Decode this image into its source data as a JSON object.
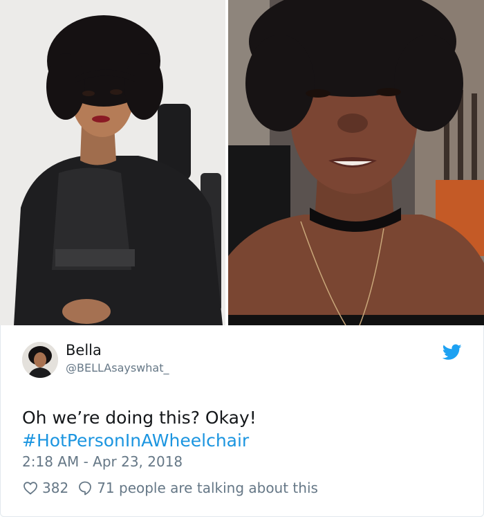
{
  "tweet": {
    "display_name": "Bella",
    "handle": "@BELLAsayswhat_",
    "text": "Oh we’re doing this? Okay!",
    "hashtag": "#HotPersonInAWheelchair",
    "timestamp": "2:18 AM - Apr 23, 2018",
    "likes": "382",
    "replies": "71 people are talking about this"
  },
  "colors": {
    "link": "#1b95e0",
    "muted": "#657786",
    "text": "#14171a",
    "twitter_blue": "#1da1f2"
  },
  "icons": {
    "brand": "twitter-bird-icon",
    "like": "heart-icon",
    "reply": "speech-bubble-icon"
  }
}
